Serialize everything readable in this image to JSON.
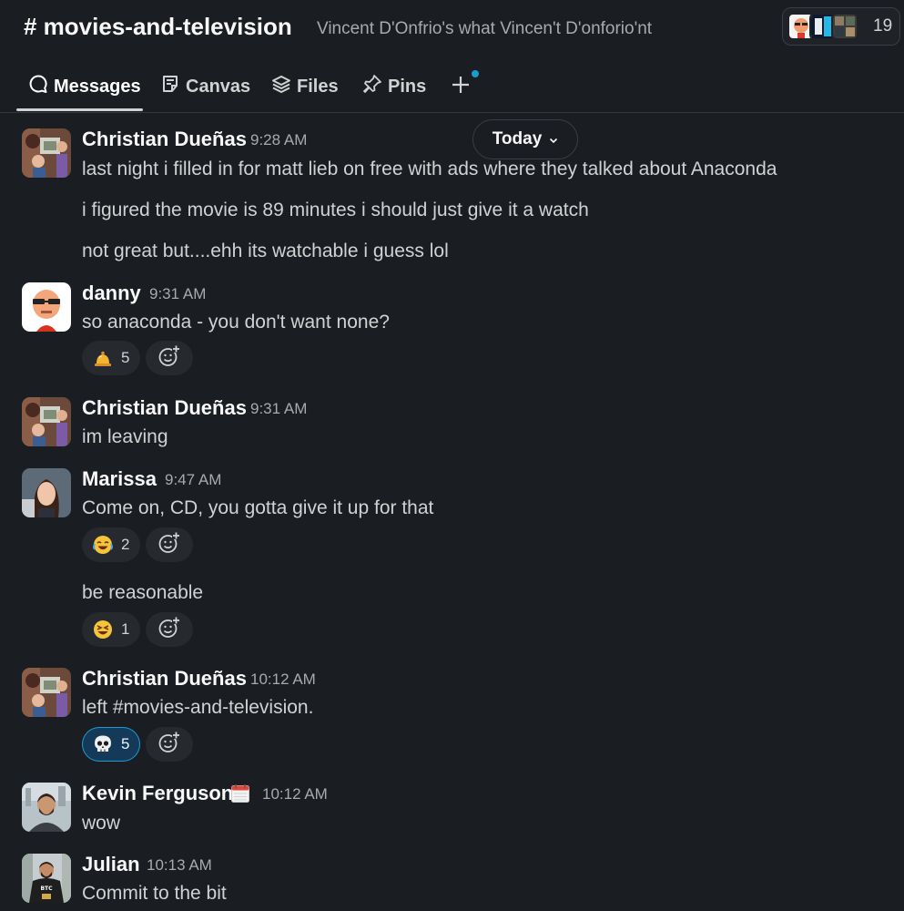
{
  "channel": {
    "name": "# movies-and-television",
    "topic": "Vincent D'Onfrio's what Vincen't D'onforio'nt",
    "member_count": "19"
  },
  "tabs": [
    {
      "label": "Messages",
      "icon": "message-icon",
      "active": true
    },
    {
      "label": "Canvas",
      "icon": "canvas-icon"
    },
    {
      "label": "Files",
      "icon": "files-icon"
    },
    {
      "label": "Pins",
      "icon": "pin-icon"
    }
  ],
  "date_divider": {
    "label": "Today"
  },
  "messages": [
    {
      "author": "Christian Dueñas",
      "time": "9:28 AM",
      "lines": [
        "last night i filled in for matt lieb on free with ads where they talked about Anaconda",
        "i figured the movie is 89 minutes i should just give it a watch",
        "not great but....ehh its watchable i guess lol"
      ]
    },
    {
      "author": "danny",
      "time": "9:31 AM",
      "lines": [
        "so anaconda - you don't want none?"
      ],
      "reactions": [
        {
          "emoji": "bell-icon",
          "count": "5"
        }
      ]
    },
    {
      "author": "Christian Dueñas",
      "time": "9:31 AM",
      "lines": [
        "im leaving"
      ]
    },
    {
      "author": "Marissa",
      "time": "9:47 AM",
      "lines": [
        "Come on, CD, you gotta give it up for that",
        "be reasonable"
      ],
      "reactions": [
        {
          "emoji": "joy-icon",
          "count": "2"
        },
        {
          "emoji": "laughing-icon",
          "count": "1"
        }
      ]
    },
    {
      "author": "Christian Dueñas",
      "time": "10:12 AM",
      "lines": [
        "left #movies-and-television."
      ],
      "reactions": [
        {
          "emoji": "skull-icon",
          "count": "5",
          "selected": true
        }
      ]
    },
    {
      "author": "Kevin Ferguson",
      "time": "10:12 AM",
      "status_emoji": "calendar-icon",
      "lines": [
        "wow"
      ]
    },
    {
      "author": "Julian",
      "time": "10:13 AM",
      "lines": [
        "Commit to the bit"
      ]
    }
  ],
  "colors": {
    "background": "#1a1d21",
    "text": "#d1d2d3",
    "muted": "#a8aaad",
    "selected_reaction": "#153a59",
    "accent": "#1d9bd1"
  }
}
